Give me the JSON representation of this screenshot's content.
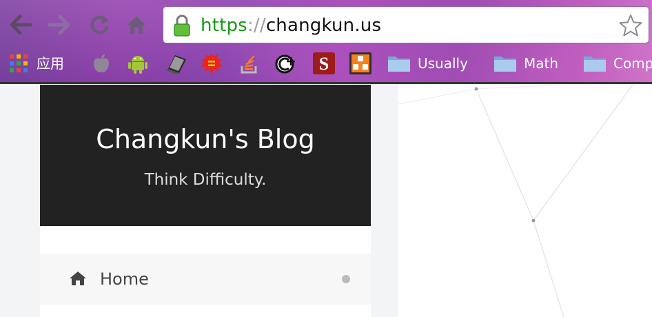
{
  "browser": {
    "url_scheme": "https",
    "url_separator": "://",
    "url_host": "changkun.us",
    "bookmarks": {
      "apps_label": "应用",
      "folders": [
        "Usually",
        "Math",
        "Comp"
      ]
    },
    "icons": {
      "back": "arrow-left-icon",
      "forward": "arrow-right-icon",
      "reload": "reload-icon",
      "home": "home-icon",
      "lock": "lock-icon",
      "star": "star-icon"
    },
    "colors": {
      "secure_green": "#149a14",
      "chrome_purple": "#8c3db0"
    }
  },
  "site": {
    "title": "Changkun's Blog",
    "subtitle": "Think Difficulty.",
    "menu": [
      {
        "label": "Home",
        "icon": "home-icon"
      }
    ]
  }
}
